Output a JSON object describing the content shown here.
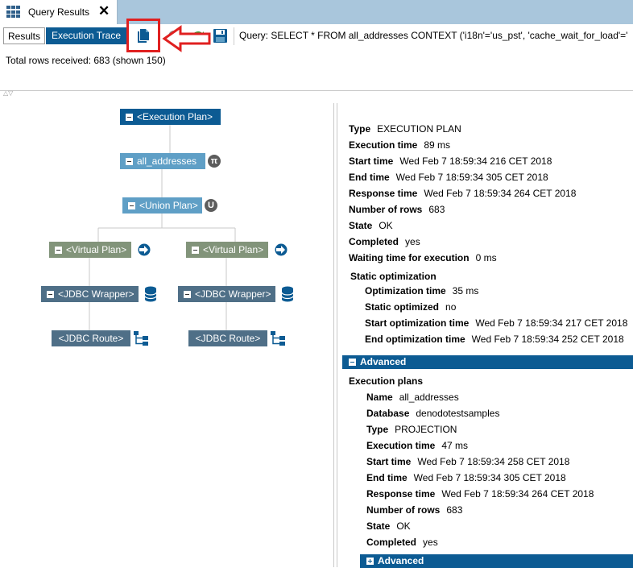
{
  "tab": {
    "title": "Query Results",
    "close": "✕"
  },
  "toolbar": {
    "results_label": "Results",
    "trace_label": "Execution Trace",
    "query": "Query: SELECT * FROM all_addresses CONTEXT ('i18n'='us_pst', 'cache_wait_for_load'='"
  },
  "status": {
    "total_rows": "Total rows received: 683 (shown 150)"
  },
  "tree": {
    "root": "<Execution Plan>",
    "projection": "all_addresses",
    "projection_badge": "π",
    "union": "<Union Plan>",
    "union_badge": "U",
    "left_virtual": "<Virtual Plan>",
    "right_virtual": "<Virtual Plan>",
    "left_wrapper": "<JDBC Wrapper>",
    "right_wrapper": "<JDBC Wrapper>",
    "left_route": "<JDBC Route>",
    "right_route": "<JDBC Route>"
  },
  "details": {
    "rows": [
      {
        "k": "Type",
        "v": "EXECUTION PLAN"
      },
      {
        "k": "Execution time",
        "v": "89 ms"
      },
      {
        "k": "Start time",
        "v": "Wed Feb 7 18:59:34 216 CET 2018"
      },
      {
        "k": "End time",
        "v": "Wed Feb 7 18:59:34 305 CET 2018"
      },
      {
        "k": "Response time",
        "v": "Wed Feb 7 18:59:34 264 CET 2018"
      },
      {
        "k": "Number of rows",
        "v": "683"
      },
      {
        "k": "State",
        "v": "OK"
      },
      {
        "k": "Completed",
        "v": "yes"
      },
      {
        "k": "Waiting time for execution",
        "v": "0 ms"
      }
    ],
    "static_title": "Static optimization",
    "static_rows": [
      {
        "k": "Optimization time",
        "v": "35 ms"
      },
      {
        "k": "Static optimized",
        "v": "no"
      },
      {
        "k": "Start optimization time",
        "v": "Wed Feb 7 18:59:34 217 CET 2018"
      },
      {
        "k": "End optimization time",
        "v": "Wed Feb 7 18:59:34 252 CET 2018"
      }
    ],
    "advanced_label": "Advanced",
    "exec_plans_title": "Execution plans",
    "plan_rows": [
      {
        "k": "Name",
        "v": "all_addresses"
      },
      {
        "k": "Database",
        "v": "denodotestsamples"
      },
      {
        "k": "Type",
        "v": "PROJECTION"
      },
      {
        "k": "Execution time",
        "v": "47 ms"
      },
      {
        "k": "Start time",
        "v": "Wed Feb 7 18:59:34 258 CET 2018"
      },
      {
        "k": "End time",
        "v": "Wed Feb 7 18:59:34 305 CET 2018"
      },
      {
        "k": "Response time",
        "v": "Wed Feb 7 18:59:34 264 CET 2018"
      },
      {
        "k": "Number of rows",
        "v": "683"
      },
      {
        "k": "State",
        "v": "OK"
      },
      {
        "k": "Completed",
        "v": "yes"
      }
    ],
    "advanced2_label": "Advanced"
  },
  "colors": {
    "accent": "#0c5b93",
    "highlight": "#e02020"
  },
  "icons": {
    "tab": "grid-icon",
    "copy": "copy-icon",
    "stop": "stop-icon",
    "refresh": "refresh-icon",
    "save": "save-icon",
    "virtual": "arrow-circle-icon",
    "wrapper": "database-icon",
    "route": "hierarchy-icon"
  }
}
